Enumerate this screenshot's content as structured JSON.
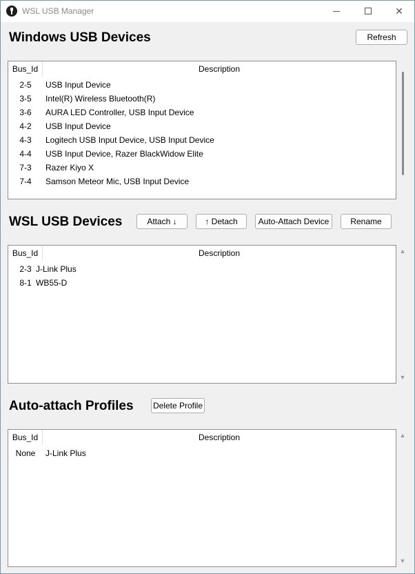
{
  "window": {
    "title": "WSL USB Manager"
  },
  "windows_section": {
    "title": "Windows USB Devices",
    "refresh_label": "Refresh",
    "columns": {
      "bus_id": "Bus_Id",
      "description": "Description"
    },
    "rows": [
      {
        "bus_id": "2-5",
        "description": "USB Input Device"
      },
      {
        "bus_id": "3-5",
        "description": "Intel(R) Wireless Bluetooth(R)"
      },
      {
        "bus_id": "3-6",
        "description": "AURA LED Controller, USB Input Device"
      },
      {
        "bus_id": "4-2",
        "description": "USB Input Device"
      },
      {
        "bus_id": "4-3",
        "description": "Logitech USB Input Device, USB Input Device"
      },
      {
        "bus_id": "4-4",
        "description": "USB Input Device, Razer BlackWidow Elite"
      },
      {
        "bus_id": "7-3",
        "description": "Razer Kiyo X"
      },
      {
        "bus_id": "7-4",
        "description": "Samson Meteor Mic, USB Input Device"
      }
    ]
  },
  "wsl_section": {
    "title": "WSL USB Devices",
    "attach_label": "Attach ↓",
    "detach_label": "↑ Detach",
    "auto_attach_label": "Auto-Attach Device",
    "rename_label": "Rename",
    "columns": {
      "bus_id": "Bus_Id",
      "description": "Description"
    },
    "rows": [
      {
        "bus_id": "2-3",
        "description": "J-Link Plus"
      },
      {
        "bus_id": "8-1",
        "description": "WB55-D"
      }
    ]
  },
  "profiles_section": {
    "title": "Auto-attach Profiles",
    "delete_label": "Delete Profile",
    "columns": {
      "bus_id": "Bus_Id",
      "description": "Description"
    },
    "rows": [
      {
        "bus_id": "None",
        "description": "J-Link Plus"
      }
    ]
  }
}
